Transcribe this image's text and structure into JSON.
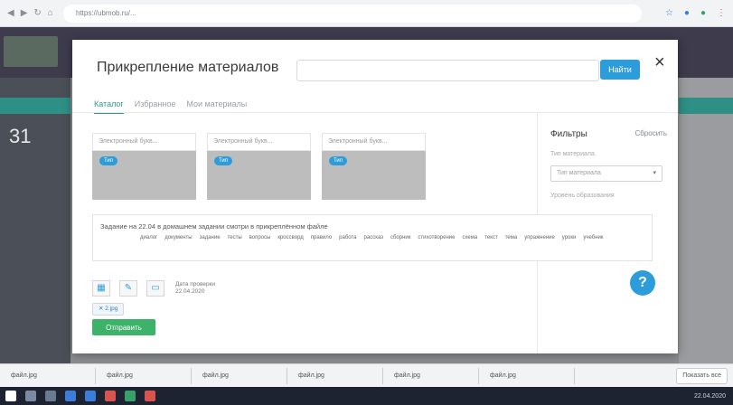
{
  "browser": {
    "url": "https://ubmob.ru/...",
    "nav_icons": [
      "back-icon",
      "forward-icon",
      "reload-icon",
      "home-icon"
    ]
  },
  "background": {
    "day_number": "31"
  },
  "modal": {
    "title": "Прикрепление материалов",
    "search_placeholder": "",
    "search_button": "Найти",
    "close_icon": "×",
    "tabs": [
      {
        "label": "Каталог",
        "active": true
      },
      {
        "label": "Избранное",
        "active": false
      },
      {
        "label": "Мои материалы",
        "active": false
      }
    ],
    "cards": [
      {
        "head": "Электронный букв...",
        "pill": "Тип"
      },
      {
        "head": "Электронный букв...",
        "pill": "Тип"
      },
      {
        "head": "Электронный букв...",
        "pill": "Тип"
      }
    ],
    "filters": {
      "title": "Фильтры",
      "reset": "Сбросить",
      "label1": "Тип материала",
      "select_value": "Тип материала",
      "label2": "Уровень образования",
      "footer": ""
    },
    "task": {
      "text": "Задание на 22.04 в домашнем задании смотри в прикреплённом файле",
      "tags": [
        "диалог",
        "документы",
        "задание",
        "тесты",
        "вопросы",
        "кроссворд",
        "правило",
        "работа",
        "рассказ",
        "сборник",
        "стихотворение",
        "схема",
        "текст",
        "тема",
        "упражнение",
        "уроки",
        "учебник"
      ]
    },
    "date_label": "Дата проверки",
    "date_value": "22.04.2020",
    "file_chip": "✕ 2.jpg",
    "submit_button": "Отправить",
    "help": "?"
  },
  "downloads": {
    "items": [
      "файл.jpg",
      "файл.jpg",
      "файл.jpg",
      "файл.jpg",
      "файл.jpg",
      "файл.jpg"
    ],
    "show_all": "Показать все"
  },
  "taskbar": {
    "tray_time": "22.04.2020"
  },
  "colors": {
    "accent": "#2d9cdb",
    "tab_active": "#2e9b8f",
    "submit": "#3db36a"
  }
}
